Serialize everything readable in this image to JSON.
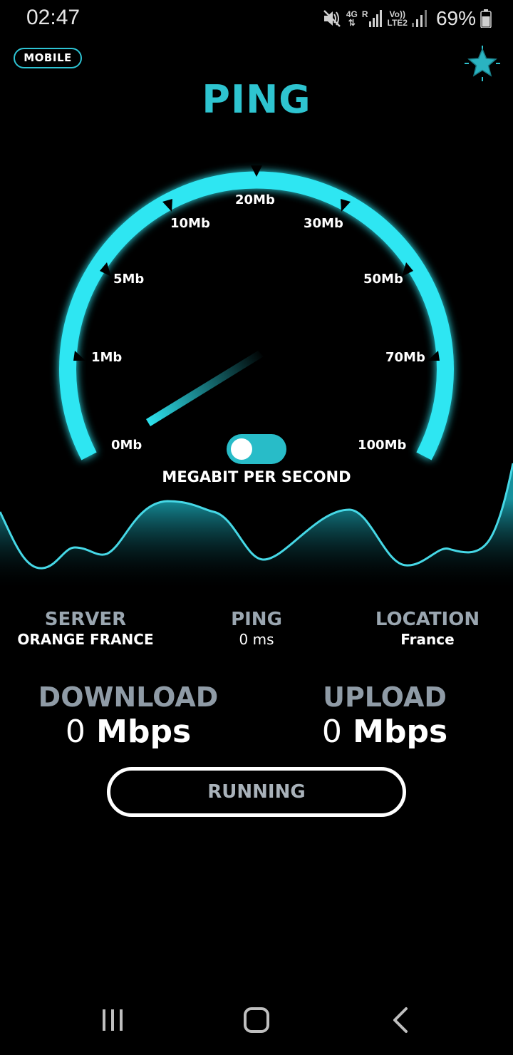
{
  "status_bar": {
    "time": "02:47",
    "network_type": "4G",
    "roaming": "R",
    "volte_top": "Vo))",
    "volte_bottom": "LTE2",
    "battery": "69%",
    "icons": [
      "mute-icon",
      "signal-icon",
      "battery-icon"
    ]
  },
  "header": {
    "mode": "MOBILE",
    "title": "PING",
    "favorite_icon": "star-icon"
  },
  "gauge": {
    "labels": [
      "0Mb",
      "1Mb",
      "5Mb",
      "10Mb",
      "20Mb",
      "30Mb",
      "50Mb",
      "70Mb",
      "100Mb"
    ],
    "unit_toggle_on": true,
    "unit_label": "MEGABIT PER SECOND",
    "accent_color": "#2ee6f2"
  },
  "info": {
    "server_title": "SERVER",
    "server_value": "ORANGE FRANCE",
    "ping_title": "PING",
    "ping_value": "0 ms",
    "location_title": "LOCATION",
    "location_value": "France"
  },
  "metrics": {
    "download_title": "DOWNLOAD",
    "download_value": "0",
    "download_unit": "Mbps",
    "upload_title": "UPLOAD",
    "upload_value": "0",
    "upload_unit": "Mbps"
  },
  "action": {
    "button_label": "RUNNING"
  },
  "nav": {
    "icons": [
      "recents-icon",
      "home-icon",
      "back-icon"
    ]
  }
}
